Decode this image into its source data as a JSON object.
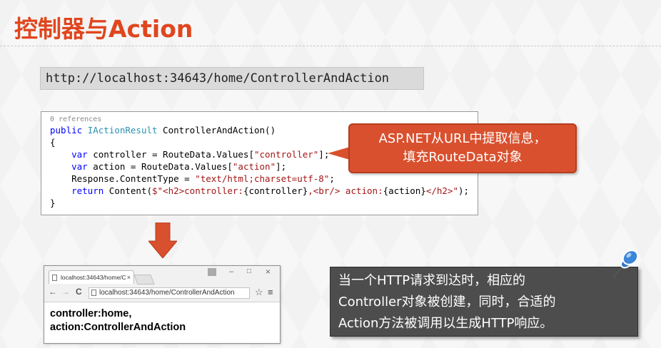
{
  "slide": {
    "title": "控制器与Action"
  },
  "url_bar": {
    "text": "http://localhost:34643/home/ControllerAndAction"
  },
  "code": {
    "refs": "0 references",
    "l1": {
      "kw": "public ",
      "type": "IActionResult",
      "rest": " ControllerAndAction()"
    },
    "l2": "{",
    "l3": {
      "kw": "var",
      "a": " controller = RouteData.Values[",
      "str": "\"controller\"",
      "b": "];"
    },
    "l4": {
      "kw": "var",
      "a": " action = RouteData.Values[",
      "str": "\"action\"",
      "b": "];"
    },
    "l5": {
      "a": "Response.ContentType = ",
      "str": "\"text/html;charset=utf-8\"",
      "b": ";"
    },
    "l6": {
      "kw": "return",
      "a": " Content(",
      "s1": "$\"<h2>controller:",
      "i1": "{controller}",
      "s2": ",<br/> action:",
      "i2": "{action}",
      "s3": "</h2>\"",
      "b": ");"
    },
    "l7": "}"
  },
  "callout": {
    "line1": "ASP.NET从URL中提取信息，",
    "line2": "填充RouteData对象"
  },
  "browser": {
    "tab_title": "localhost:34643/home/C",
    "tab_close": "×",
    "address": "localhost:34643/home/ControllerAndAction",
    "back": "←",
    "forward": "→",
    "reload": "C",
    "star": "☆",
    "menu": "≡",
    "minimize": "–",
    "maximize": "□",
    "close": "×",
    "content_line1": "controller:home,",
    "content_line2": "action:ControllerAndAction"
  },
  "note": {
    "line1": "当一个HTTP请求到达时，相应的",
    "line2": "Controller对象被创建，同时，合适的",
    "line3": "Action方法被调用以生成HTTP响应。"
  },
  "colors": {
    "title": "#e0461e",
    "callout": "#d9502e",
    "arrow": "#d9502e",
    "note_bg": "#4d4d4d",
    "pin": "#2f76c8"
  },
  "icons": [
    "down-arrow-icon",
    "pushpin-icon",
    "page-icon",
    "star-icon",
    "menu-icon"
  ]
}
